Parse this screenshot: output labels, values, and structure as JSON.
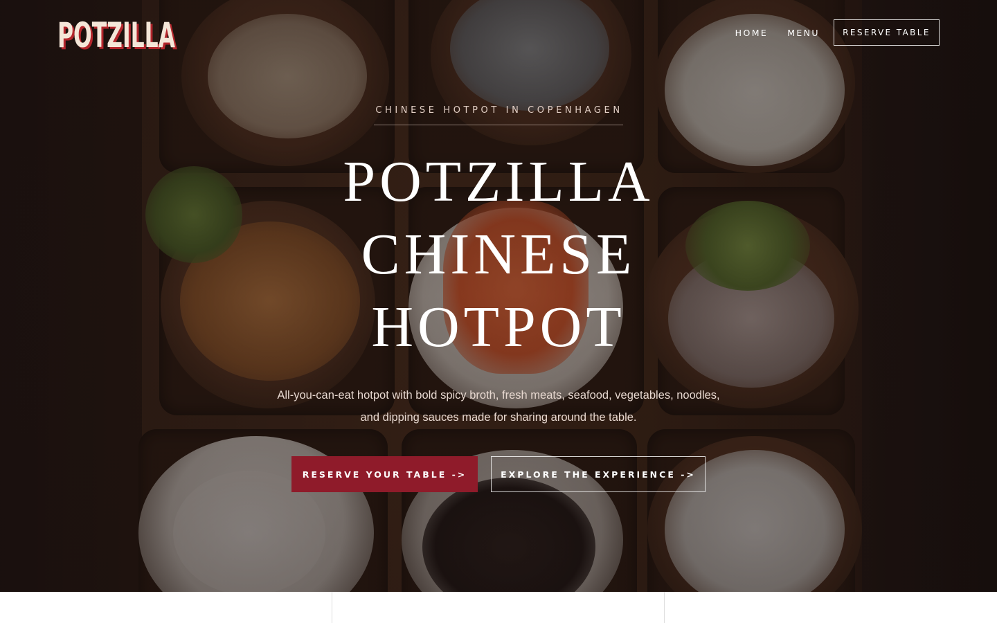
{
  "brand": {
    "logo_text": "POTZILLA",
    "logo_color": "#f4e6d8",
    "logo_shadow_color": "#b3262c"
  },
  "nav": {
    "home": "HOME",
    "menu": "MENU",
    "reserve": "RESERVE TABLE"
  },
  "hero": {
    "eyebrow": "CHINESE HOTPOT IN COPENHAGEN",
    "headline_lines": [
      "POTZILLA",
      "CHINESE",
      "HOTPOT"
    ],
    "subtext_lines": [
      "All-you-can-eat hotpot with bold spicy broth, fresh meats, seafood, vegetables, noodles,",
      "and dipping sauces made for sharing around the table."
    ],
    "primary_cta": "RESERVE YOUR TABLE ->",
    "secondary_cta": "EXPLORE THE EXPERIENCE ->",
    "background_image": "hotpot-ingredients-board"
  },
  "colors": {
    "accent": "#8f1b2a",
    "text_light": "#ffffff",
    "overlay": "#190f0d"
  }
}
